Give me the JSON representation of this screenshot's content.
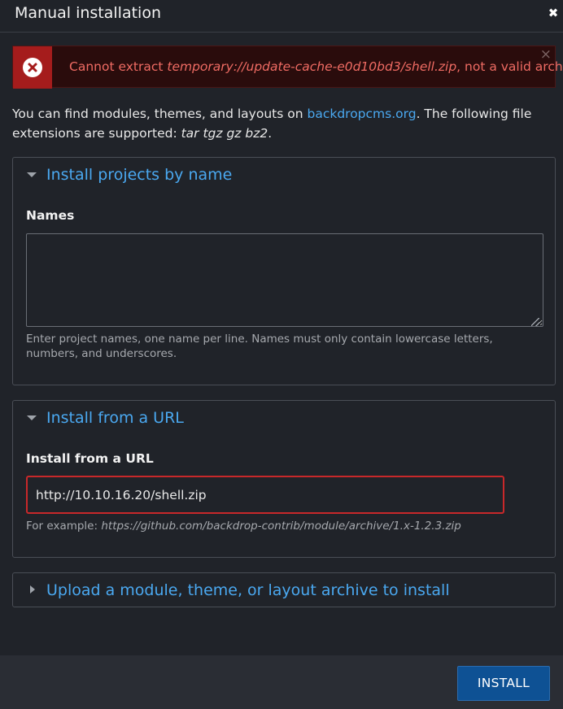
{
  "dialog": {
    "title": "Manual installation",
    "close_symbol": "✖"
  },
  "alert": {
    "prefix": "Cannot extract ",
    "path": "temporary://update-cache-e0d10bd3/shell.zip",
    "suffix": ", not a valid archive.",
    "close_symbol": "×",
    "icon": "error-x-icon",
    "color": "#a51c1c"
  },
  "intro": {
    "text1": "You can find modules, themes, and layouts on ",
    "link": "backdropcms.org",
    "text2": ". The following file extensions are supported: ",
    "extensions": "tar tgz gz bz2",
    "text3": "."
  },
  "by_name": {
    "legend": "Install projects by name",
    "label": "Names",
    "value": "",
    "help": "Enter project names, one name per line. Names must only contain lowercase letters, numbers, and underscores."
  },
  "by_url": {
    "legend": "Install from a URL",
    "label": "Install from a URL",
    "value": "http://10.10.16.20/shell.zip",
    "help_prefix": "For example: ",
    "help_example": "https://github.com/backdrop-contrib/module/archive/1.x-1.2.3.zip"
  },
  "upload": {
    "legend": "Upload a module, theme, or layout archive to install"
  },
  "footer": {
    "install_label": "INSTALL"
  },
  "colors": {
    "accent": "#4aa8f0",
    "button": "#0e5194",
    "error_text": "#ef6b63",
    "background": "#202329"
  }
}
